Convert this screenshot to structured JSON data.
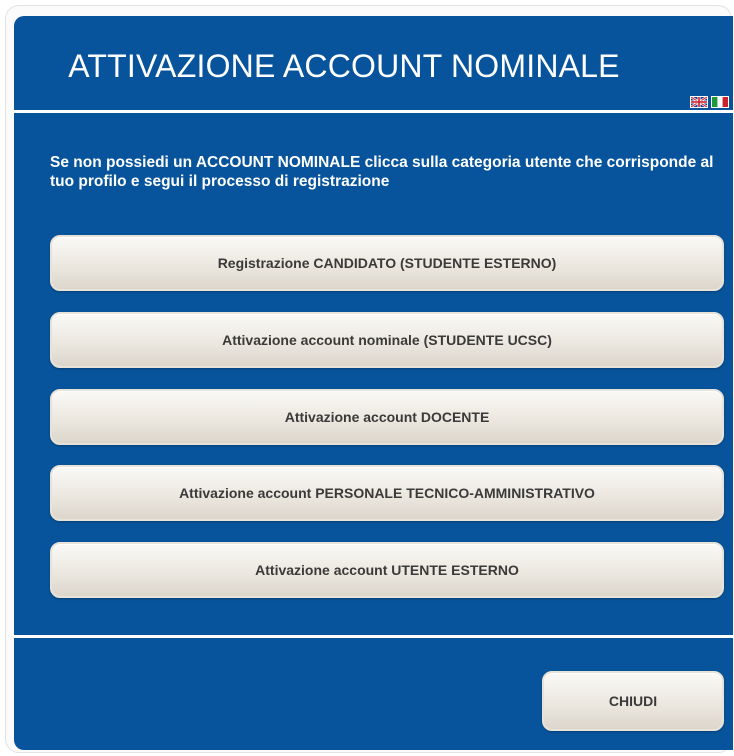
{
  "dialog": {
    "title": "ATTIVAZIONE ACCOUNT NOMINALE",
    "intro": "Se non possiedi un ACCOUNT NOMINALE clicca sulla categoria utente che corrisponde al tuo profilo e segui il processo di registrazione",
    "language_flags": [
      "english-flag-icon",
      "italian-flag-icon"
    ],
    "buttons": [
      {
        "label": "Registrazione CANDIDATO (STUDENTE ESTERNO)"
      },
      {
        "label": "Attivazione account nominale (STUDENTE UCSC)"
      },
      {
        "label": "Attivazione account DOCENTE"
      },
      {
        "label": "Attivazione account PERSONALE TECNICO-AMMINISTRATIVO"
      },
      {
        "label": "Attivazione account UTENTE ESTERNO"
      }
    ],
    "close_label": "CHIUDI"
  },
  "colors": {
    "panel": "#07549c",
    "button_text": "#3a3a3a",
    "divider": "#ffffff"
  }
}
